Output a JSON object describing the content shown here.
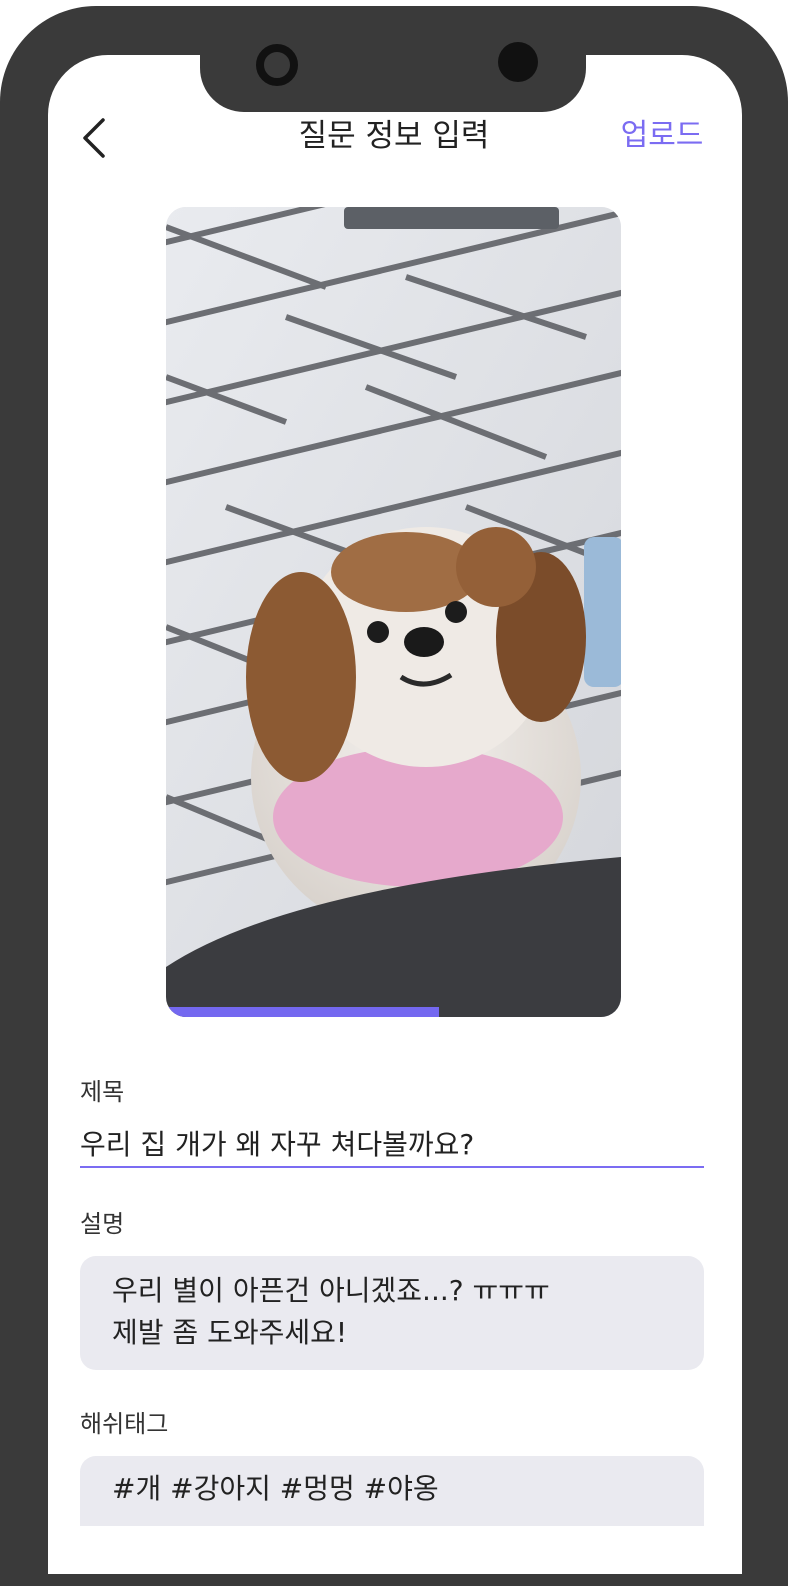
{
  "header": {
    "title": "질문 정보 입력",
    "upload_label": "업로드",
    "back_icon": "chevron-left-icon"
  },
  "photo": {
    "description_icon": "dog-photo",
    "progress_fraction": 0.6
  },
  "form": {
    "title_label": "제목",
    "title_value": "우리 집 개가 왜 자꾸 쳐다볼까요?",
    "description_label": "설명",
    "description_lines": [
      "우리 별이 아픈건 아니겠죠...? ㅠㅠㅠ",
      "제발 좀 도와주세요!"
    ],
    "hashtag_label": "해쉬태그",
    "hashtag_value": "#개 #강아지 #멍멍 #야옹"
  },
  "colors": {
    "accent": "#7b6cf2",
    "frame": "#3a3a3a",
    "field_bg": "#eaeaf0"
  }
}
